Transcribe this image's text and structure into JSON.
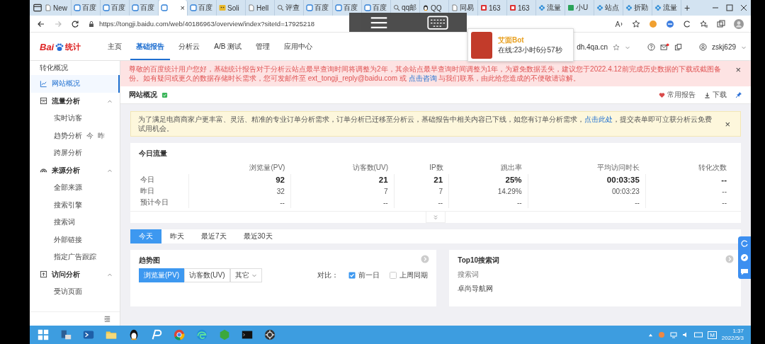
{
  "browser": {
    "tabs": [
      {
        "label": "New",
        "kind": "page",
        "selected": false
      },
      {
        "label": "百度",
        "kind": "square",
        "selected": false
      },
      {
        "label": "百度",
        "kind": "square",
        "selected": false
      },
      {
        "label": "百度",
        "kind": "square",
        "selected": false
      },
      {
        "kind": "square",
        "selected": true,
        "close": "×"
      },
      {
        "label": "百度",
        "kind": "square",
        "selected": false
      },
      {
        "label": "Soli",
        "kind": "face",
        "selected": false
      },
      {
        "label": "Hell",
        "kind": "page",
        "selected": false
      },
      {
        "label": "评查",
        "kind": "search",
        "selected": false
      },
      {
        "label": "百度",
        "kind": "square",
        "selected": false
      },
      {
        "label": "百度",
        "kind": "square",
        "selected": false
      },
      {
        "label": "百度",
        "kind": "square",
        "selected": false
      },
      {
        "label": "qq邮",
        "kind": "search",
        "selected": false
      },
      {
        "label": "QQ",
        "kind": "qq",
        "selected": false
      },
      {
        "label": "同易",
        "kind": "page",
        "selected": false
      },
      {
        "label": "163",
        "kind": "red",
        "selected": false
      },
      {
        "label": "163",
        "kind": "red",
        "selected": false
      },
      {
        "label": "流量",
        "kind": "flower",
        "selected": false
      },
      {
        "label": "小U",
        "kind": "green",
        "selected": false
      },
      {
        "label": "站点",
        "kind": "flower",
        "selected": false
      },
      {
        "label": "折勤",
        "kind": "flower",
        "selected": false
      },
      {
        "label": "流量",
        "kind": "flower",
        "selected": false
      }
    ],
    "new_tab": "+",
    "url": "https://tongji.baidu.com/web/40186963/overview/index?siteId=17925218"
  },
  "header": {
    "logo_latin": "Bai",
    "logo_suffix": "统计",
    "nav": [
      {
        "label": "主页",
        "selected": false
      },
      {
        "label": "基础报告",
        "selected": true
      },
      {
        "label": "分析云",
        "selected": false
      },
      {
        "label": "A/B 测试",
        "selected": false
      },
      {
        "label": "管理",
        "selected": false
      },
      {
        "label": "应用中心",
        "selected": false
      }
    ],
    "site": "dh.4qa.cn",
    "user": "zskj629"
  },
  "sidebar": {
    "items": [
      {
        "kind": "link",
        "label": "转化概况",
        "selected": false
      },
      {
        "kind": "chartlink",
        "label": "网站概况",
        "selected": true
      },
      {
        "kind": "group",
        "label": "流量分析",
        "expanded": true,
        "children": [
          {
            "label": "实时访客",
            "selected": false
          },
          {
            "label": "趋势分析",
            "extras": [
              "今",
              "昨"
            ],
            "selected": false
          },
          {
            "label": "跨屏分析",
            "selected": false
          }
        ]
      },
      {
        "kind": "group",
        "label": "来源分析",
        "expanded": true,
        "children": [
          {
            "label": "全部来源",
            "selected": false
          },
          {
            "label": "搜索引擎",
            "selected": false
          },
          {
            "label": "搜索词",
            "selected": false
          },
          {
            "label": "外部链接",
            "selected": false
          },
          {
            "label": "指定广告跟踪",
            "selected": false
          }
        ]
      },
      {
        "kind": "group",
        "label": "访问分析",
        "expanded": true,
        "children": [
          {
            "label": "受访页面",
            "selected": false
          }
        ]
      }
    ]
  },
  "notice": {
    "before": "尊敬的百度统计用户您好，基础统计报告对于分析云站点最早查询时间将调整为2年，其余站点最早查询时间调整为1年，为避免数据丢失，建议您于2022.4.12前完成历史数据的下载或截图备份。如有疑问或更久的数据存储时长需求，您可发邮件至 ext_tongji_reply@baidu.com 或 ",
    "link": "点击咨询",
    "after": " 与我们联系，由此给您造成的不便敬请谅解。",
    "close": "×"
  },
  "page_title": {
    "title": "网站概况",
    "actions": [
      {
        "label": "常用报告",
        "kind": "heart"
      },
      {
        "label": "下载",
        "kind": "download"
      }
    ]
  },
  "tip": {
    "before": "为了满足电商商家户更丰富、灵活、精准的专业订单分析需求，订单分析已迁移至分析云，基础报告中相关内容已下线，如您有订单分析需求，",
    "link": "点击此处",
    "after": "，提交表单即可立获分析云免费试用机会。",
    "close": "×"
  },
  "today_traffic": {
    "title": "今日流量",
    "columns": [
      "浏览量(PV)",
      "访客数(UV)",
      "IP数",
      "跳出率",
      "平均访问时长",
      "转化次数"
    ],
    "rows": [
      {
        "label": "今日",
        "cells": [
          "92",
          "21",
          "21",
          "25%",
          "00:03:35",
          "--"
        ]
      },
      {
        "label": "昨日",
        "cells": [
          "32",
          "7",
          "7",
          "14.29%",
          "00:03:23",
          "--"
        ]
      },
      {
        "label": "预计今日",
        "cells": [
          "--",
          "--",
          "--",
          "--",
          "--",
          "--"
        ]
      }
    ]
  },
  "date_range": [
    {
      "label": "今天",
      "selected": true
    },
    {
      "label": "昨天",
      "selected": false
    },
    {
      "label": "最近7天",
      "selected": false
    },
    {
      "label": "最近30天",
      "selected": false
    }
  ],
  "trend": {
    "title": "趋势图",
    "metrics": [
      {
        "label": "浏览量(PV)",
        "selected": true
      },
      {
        "label": "访客数(UV)",
        "selected": false
      }
    ],
    "more": "其它",
    "compare_label": "对比：",
    "compare": [
      {
        "label": "前一日",
        "checked": true
      },
      {
        "label": "上周同期",
        "checked": false
      }
    ]
  },
  "top_search": {
    "title": "Top10搜索词",
    "column": "搜索词",
    "rows": [
      "卓尚导航网"
    ]
  },
  "bot_popup": {
    "name": "艾面Bot",
    "status": "在线:23小时6分57秒"
  },
  "taskbar": {
    "tray_letter": "M",
    "time": "1:37",
    "date": "2022/5/3"
  }
}
